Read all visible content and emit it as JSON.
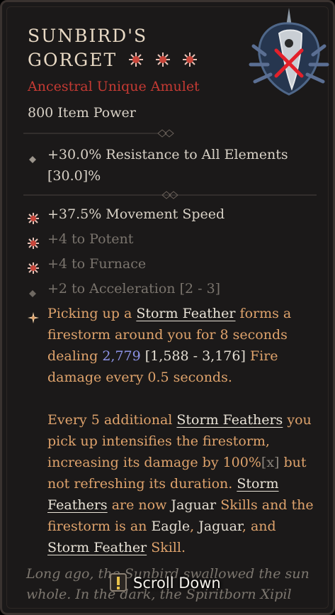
{
  "item": {
    "name_line1": "SUNBIRD'S",
    "name_line2": "GORGET",
    "star_count": 3,
    "type": "Ancestral Unique Amulet",
    "power": "800 Item Power",
    "image_icon": "amulet-with-red-cross-icon"
  },
  "implicit": [
    {
      "text": "+30.0% Resistance to All Elements [30.0]%",
      "icon": "diamond-icon"
    }
  ],
  "affixes": [
    {
      "text": "+37.5% Movement Speed",
      "icon": "greater-affix-icon",
      "dim": false
    },
    {
      "text": "+4 to Potent",
      "icon": "greater-affix-icon",
      "dim": true
    },
    {
      "text": "+4 to Furnace",
      "icon": "greater-affix-icon",
      "dim": true
    },
    {
      "text": "+2 to Acceleration [2 - 3]",
      "icon": "diamond-icon",
      "dim": true
    }
  ],
  "unique": {
    "icon": "unique-power-icon",
    "p1_a": "Picking up a ",
    "p1_link": "Storm Feather",
    "p1_b": " forms a firestorm around you for 8 seconds dealing ",
    "p1_value": "2,779",
    "p1_range": " [1,588 - 3,176] ",
    "p1_c": "Fire damage every 0.5 seconds.",
    "p2_a": "Every 5 additional ",
    "p2_link": "Storm Feathers",
    "p2_b": " you pick up intensifies the firestorm, increasing its damage by 100%",
    "p2_x": "[x]",
    "p2_c": " but not refreshing its duration. ",
    "p2_link2": "Storm Feathers",
    "p2_d": " are now ",
    "p2_jaguar": "Jaguar",
    "p2_e": " Skills and the firestorm is an ",
    "p2_eagle": "Eagle",
    "p2_f": ", ",
    "p2_jaguar2": "Jaguar",
    "p2_g": ", and ",
    "p2_link3": "Storm Feather",
    "p2_h": " ",
    "p2_skill": "Skill",
    "p2_i": "."
  },
  "flavor": "Long ago, the Sunbird swallowed the sun whole. In the dark, the Spiritborn Xipil",
  "scroll_hint": {
    "label": "Scroll Down",
    "icon": "exclamation-icon"
  },
  "colors": {
    "title": "#e8d9c4",
    "unique_red": "#c53a33",
    "unique_text": "#dfa36c",
    "value_blue": "#8d93e6",
    "background": "#1b1919"
  }
}
